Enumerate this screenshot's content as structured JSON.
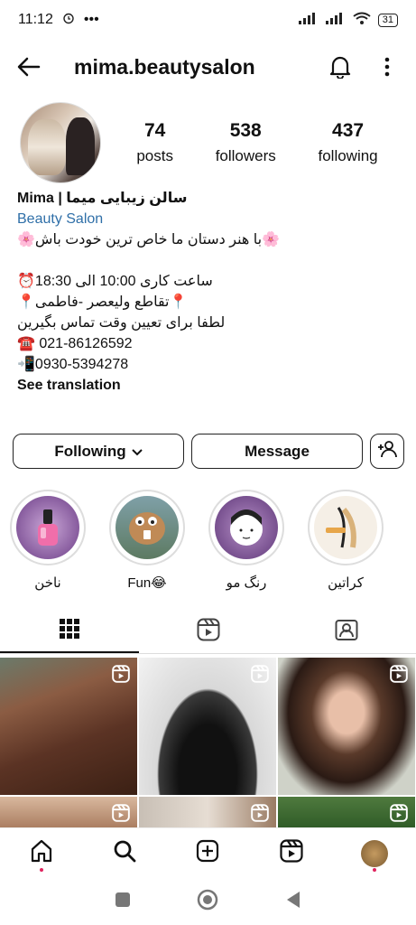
{
  "status": {
    "time": "11:12",
    "battery": "31"
  },
  "header": {
    "title": "mima.beautysalon"
  },
  "stats": [
    {
      "num": "74",
      "label": "posts"
    },
    {
      "num": "538",
      "label": "followers"
    },
    {
      "num": "437",
      "label": "following"
    }
  ],
  "bio": {
    "name": "Mima | سالن زیبایی میما",
    "category": "Beauty Salon",
    "line1": "🌸با هنر دستان ما خاص ترین خودت باش🌸",
    "hours": "⏰ساعت کاری 10:00 الی 18:30",
    "address": "📍تقاطع ولیعصر -فاطمی📍",
    "appointment": "لطفا برای تعیین وقت تماس بگیرین",
    "phone": "☎️ 021-86126592",
    "mobile": "📲0930-5394278",
    "see_translation": "See translation"
  },
  "buttons": {
    "following": "Following",
    "message": "Message"
  },
  "highlights": [
    {
      "label": "ناخن",
      "icon": "nail-polish-icon"
    },
    {
      "label": "Fun😂",
      "icon": "cartoon-icon"
    },
    {
      "label": "رنگ مو",
      "icon": "hair-color-icon"
    },
    {
      "label": "کراتین",
      "icon": "keratin-icon"
    }
  ],
  "colors": {
    "link": "#2f6fa8",
    "notification_dot": "#e0245e"
  }
}
